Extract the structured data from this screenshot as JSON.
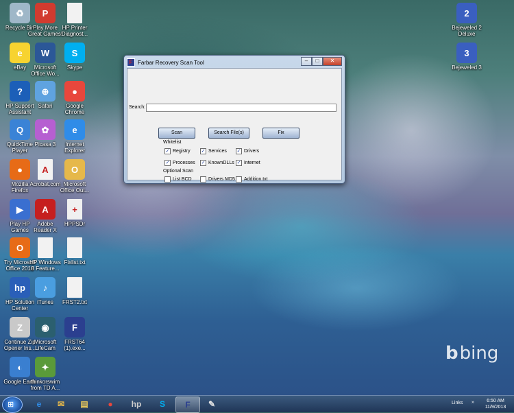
{
  "desktop": {
    "icons": [
      {
        "label": "Recycle Bin",
        "icon": "recycle-bin-icon",
        "color": "#9fb7c8",
        "glyph": "♻"
      },
      {
        "label": "Play More\nGreat Games!",
        "icon": "pop-cap-icon",
        "color": "#d23b2f",
        "glyph": "P"
      },
      {
        "label": "HP Printer\nDiagnost...",
        "icon": "document-icon",
        "color": "#f2f2f2",
        "glyph": ""
      },
      {
        "label": "eBay",
        "icon": "ebay-icon",
        "color": "#f7d330",
        "glyph": "e"
      },
      {
        "label": "Microsoft\nOffice Wo...",
        "icon": "word-icon",
        "color": "#2b5797",
        "glyph": "W"
      },
      {
        "label": "Skype",
        "icon": "skype-icon",
        "color": "#00aff0",
        "glyph": "S"
      },
      {
        "label": "HP Support\nAssistant",
        "icon": "help-icon",
        "color": "#1c5fb8",
        "glyph": "?"
      },
      {
        "label": "Safari",
        "icon": "safari-icon",
        "color": "#5fa3e0",
        "glyph": "⊕"
      },
      {
        "label": "Google\nChrome",
        "icon": "chrome-icon",
        "color": "#e8473c",
        "glyph": "●"
      },
      {
        "label": "QuickTime\nPlayer",
        "icon": "quicktime-icon",
        "color": "#3a83d6",
        "glyph": "Q"
      },
      {
        "label": "Picasa 3",
        "icon": "picasa-icon",
        "color": "#b65fd1",
        "glyph": "✿"
      },
      {
        "label": "Internet\nExplorer",
        "icon": "ie-icon",
        "color": "#2f8ce8",
        "glyph": "e"
      },
      {
        "label": "Mozilla\nFirefox",
        "icon": "firefox-icon",
        "color": "#e76b17",
        "glyph": "●"
      },
      {
        "label": "Acrobat.com",
        "icon": "acrobat-icon",
        "color": "#f3f3f3",
        "glyph": "A"
      },
      {
        "label": "Microsoft\nOffice Out...",
        "icon": "outlook-icon",
        "color": "#e6b84a",
        "glyph": "O"
      },
      {
        "label": "Play HP\nGames",
        "icon": "hp-games-icon",
        "color": "#3a6fd0",
        "glyph": "▶"
      },
      {
        "label": "Adobe\nReader X",
        "icon": "adobe-reader-icon",
        "color": "#c61f1f",
        "glyph": "A"
      },
      {
        "label": "HPPSDr",
        "icon": "hppsdr-icon",
        "color": "#f0f0f0",
        "glyph": "+"
      },
      {
        "label": "Try Microsoft\nOffice 2010",
        "icon": "office-icon",
        "color": "#e76b17",
        "glyph": "O"
      },
      {
        "label": "HP Windows\n8 Feature...",
        "icon": "document-icon",
        "color": "#f2f2f2",
        "glyph": ""
      },
      {
        "label": "Fixlist.txt",
        "icon": "text-file-icon",
        "color": "#f2f2f2",
        "glyph": ""
      },
      {
        "label": "HP Solution\nCenter",
        "icon": "hp-solution-icon",
        "color": "#2a5fb8",
        "glyph": "hp"
      },
      {
        "label": "iTunes",
        "icon": "itunes-icon",
        "color": "#4a9ee0",
        "glyph": "♪"
      },
      {
        "label": "FRST2.txt",
        "icon": "text-file-icon",
        "color": "#f2f2f2",
        "glyph": ""
      },
      {
        "label": "Continue Zip\nOpener Ins...",
        "icon": "zip-icon",
        "color": "#c9c9c9",
        "glyph": "Z"
      },
      {
        "label": "Microsoft\nLifeCam",
        "icon": "lifecam-icon",
        "color": "#2b5f6f",
        "glyph": "◉"
      },
      {
        "label": "FRST64\n(1).exe...",
        "icon": "frst-icon",
        "color": "#2b3f8f",
        "glyph": "F"
      },
      {
        "label": "Google Earth",
        "icon": "google-earth-icon",
        "color": "#3a7fd0",
        "glyph": "◐"
      },
      {
        "label": "thinkorswim\nfrom TD A...",
        "icon": "thinkorswim-icon",
        "color": "#5a9a3a",
        "glyph": "✦"
      },
      {
        "label": "Bejeweled 2\nDeluxe",
        "icon": "bejeweled-2-icon",
        "color": "#3a5fc0",
        "glyph": "2"
      },
      {
        "label": "Bejeweled 3",
        "icon": "bejeweled-3-icon",
        "color": "#3a5fc0",
        "glyph": "3"
      }
    ],
    "bing": {
      "b": "b",
      "text": "bing"
    }
  },
  "window": {
    "title": "Farbar Recovery Scan Tool",
    "caption_min": "–",
    "caption_max": "□",
    "caption_close": "✕",
    "search_label": "Search:",
    "search_value": "",
    "buttons": {
      "scan": "Scan",
      "search_files": "Search File(s)",
      "fix": "Fix"
    },
    "whitelist": {
      "title": "Whitelist",
      "items": [
        {
          "label": "Registry",
          "checked": true
        },
        {
          "label": "Services",
          "checked": true
        },
        {
          "label": "Drivers",
          "checked": true
        },
        {
          "label": "Processes",
          "checked": true
        },
        {
          "label": "KnownDLLs",
          "checked": true
        },
        {
          "label": "Internet",
          "checked": true
        }
      ]
    },
    "optional_scan": {
      "title": "Optional Scan",
      "items": [
        {
          "label": "List BCD",
          "checked": false
        },
        {
          "label": "Drivers MD5",
          "checked": false
        },
        {
          "label": "Addition.txt",
          "checked": false
        }
      ]
    },
    "check_mark": "✓"
  },
  "taskbar": {
    "start_glyph": "⊞",
    "items": [
      {
        "name": "ie",
        "glyph": "e",
        "color": "#2f8ce8"
      },
      {
        "name": "mail",
        "glyph": "✉",
        "color": "#e6b84a"
      },
      {
        "name": "explorer",
        "glyph": "▤",
        "color": "#e6c65a"
      },
      {
        "name": "chrome",
        "glyph": "●",
        "color": "#e8473c"
      },
      {
        "name": "hp",
        "glyph": "hp",
        "color": "#cccccc"
      },
      {
        "name": "skype",
        "glyph": "S",
        "color": "#00aff0"
      },
      {
        "name": "frst",
        "glyph": "F",
        "color": "#2b3f8f",
        "active": true
      },
      {
        "name": "paint",
        "glyph": "✎",
        "color": "#e6e6e6"
      }
    ],
    "links": "Links",
    "tray_arrow": "»",
    "time": "6:50 AM",
    "date": "11/9/2013"
  }
}
